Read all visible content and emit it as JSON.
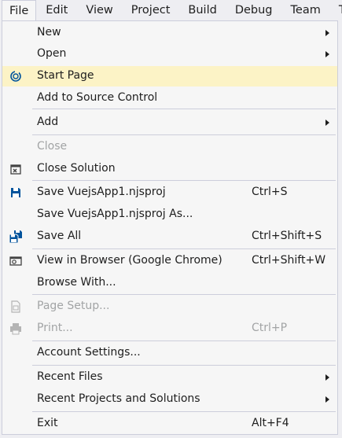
{
  "menubar": {
    "items": [
      {
        "label": "File"
      },
      {
        "label": "Edit"
      },
      {
        "label": "View"
      },
      {
        "label": "Project"
      },
      {
        "label": "Build"
      },
      {
        "label": "Debug"
      },
      {
        "label": "Team"
      },
      {
        "label": "T"
      }
    ]
  },
  "file_menu": {
    "new": {
      "label": "New"
    },
    "open": {
      "label": "Open"
    },
    "start_page": {
      "label": "Start Page",
      "icon": "start-page-icon"
    },
    "add_to_source_control": {
      "label": "Add to Source Control"
    },
    "add": {
      "label": "Add"
    },
    "close": {
      "label": "Close"
    },
    "close_solution": {
      "label": "Close Solution",
      "icon": "close-solution-icon"
    },
    "save": {
      "label": "Save VuejsApp1.njsproj",
      "shortcut": "Ctrl+S",
      "icon": "save-icon"
    },
    "save_as": {
      "label": "Save VuejsApp1.njsproj As..."
    },
    "save_all": {
      "label": "Save All",
      "shortcut": "Ctrl+Shift+S",
      "icon": "save-all-icon"
    },
    "view_in_browser": {
      "label": "View in Browser (Google Chrome)",
      "shortcut": "Ctrl+Shift+W",
      "icon": "view-in-browser-icon"
    },
    "browse_with": {
      "label": "Browse With..."
    },
    "page_setup": {
      "label": "Page Setup...",
      "icon": "page-setup-icon"
    },
    "print": {
      "label": "Print...",
      "shortcut": "Ctrl+P",
      "icon": "printer-icon"
    },
    "account_settings": {
      "label": "Account Settings..."
    },
    "recent_files": {
      "label": "Recent Files"
    },
    "recent_projects": {
      "label": "Recent Projects and Solutions"
    },
    "exit": {
      "label": "Exit",
      "shortcut": "Alt+F4"
    }
  },
  "colors": {
    "highlight": "#fcf3c6",
    "menu_background": "#f6f6f6",
    "border": "#cccedb",
    "disabled_text": "#a2a4a5",
    "icon_blue": "#00539c"
  }
}
